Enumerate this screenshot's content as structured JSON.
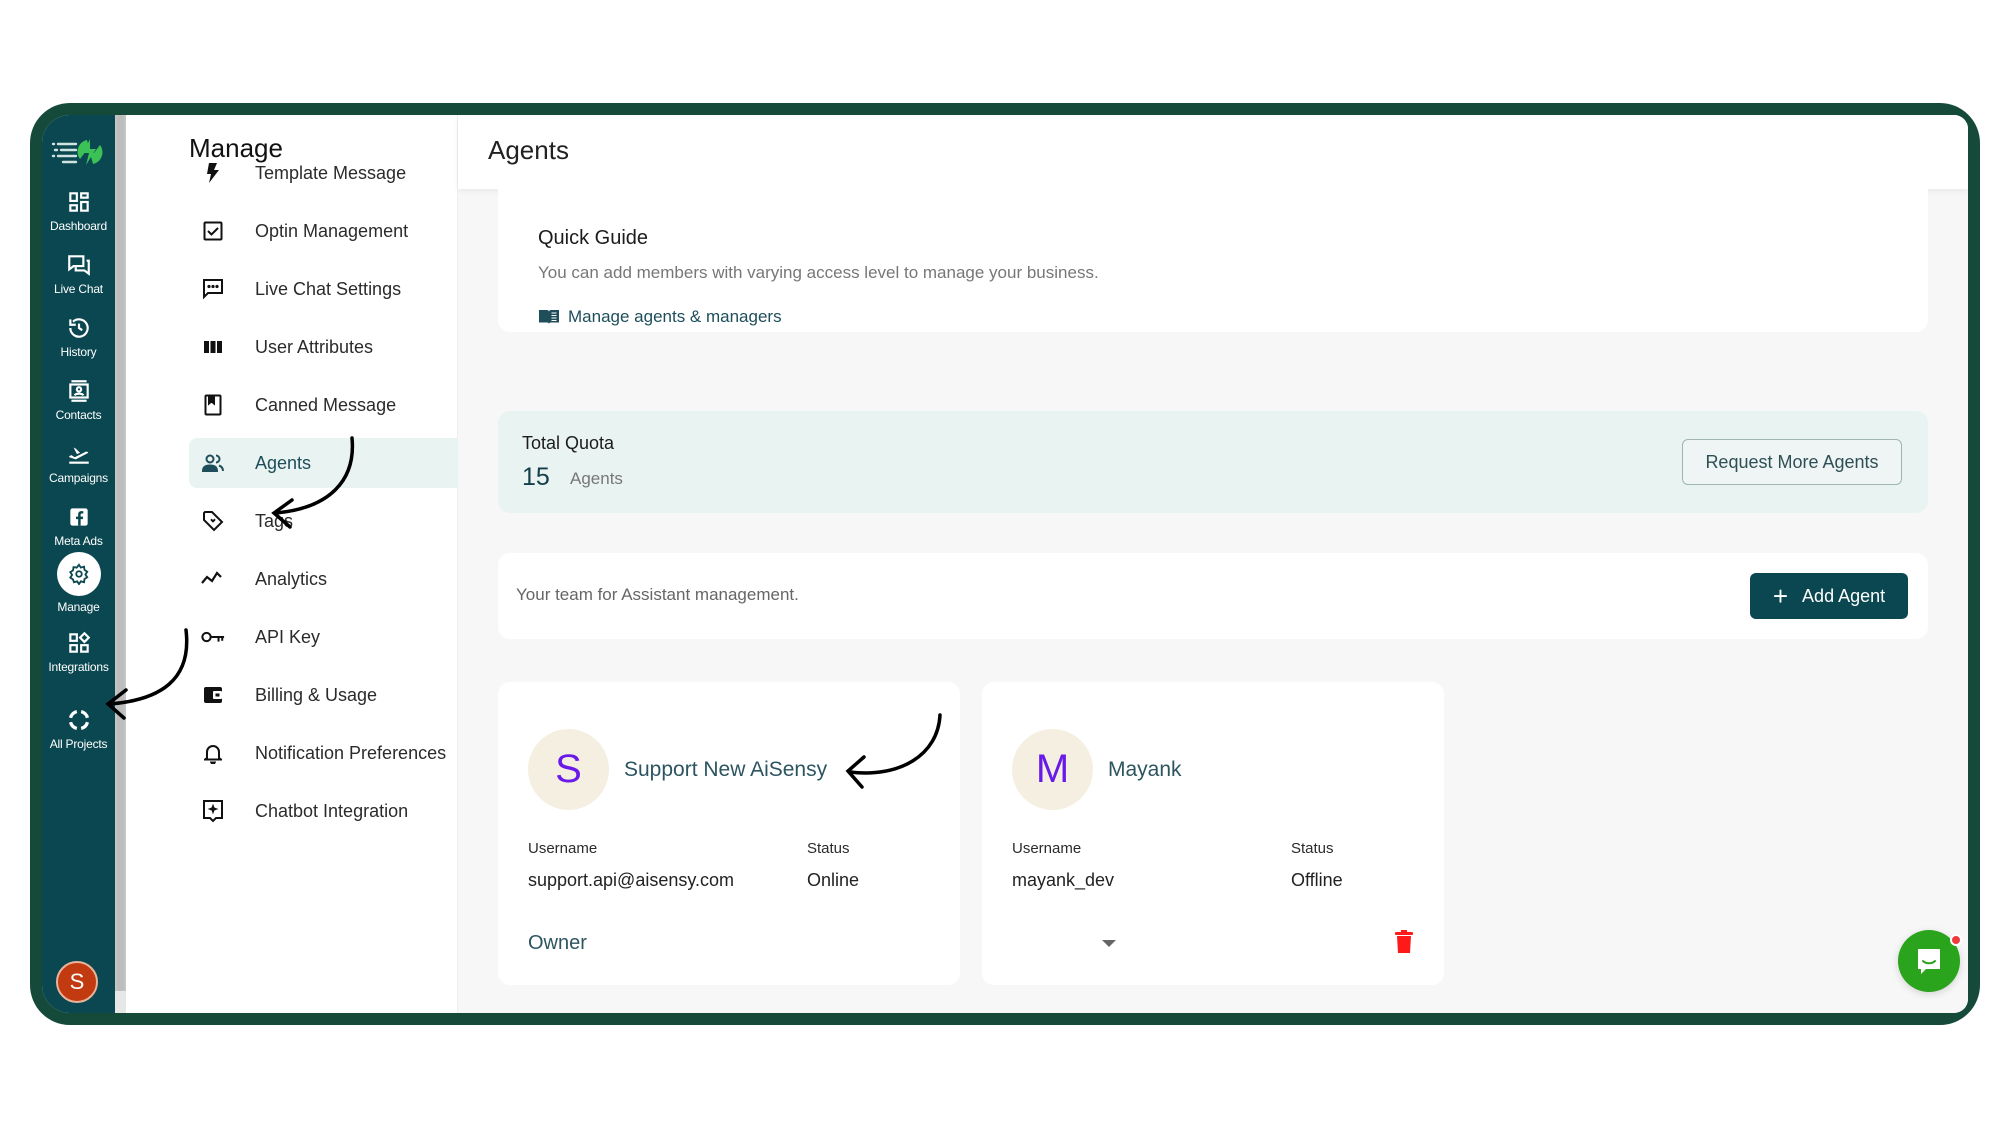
{
  "nav": {
    "items": [
      {
        "label": "Dashboard",
        "icon": "dashboard-icon"
      },
      {
        "label": "Live Chat",
        "icon": "live-chat-icon"
      },
      {
        "label": "History",
        "icon": "history-icon"
      },
      {
        "label": "Contacts",
        "icon": "contacts-icon"
      },
      {
        "label": "Campaigns",
        "icon": "campaigns-icon"
      },
      {
        "label": "Meta Ads",
        "icon": "facebook-icon"
      },
      {
        "label": "Manage",
        "icon": "gear-icon",
        "active": true
      },
      {
        "label": "Integrations",
        "icon": "integrations-icon"
      },
      {
        "label": "All Projects",
        "icon": "projects-icon"
      }
    ],
    "user_initial": "S"
  },
  "manage": {
    "title": "Manage",
    "items": [
      {
        "label": "Template Message",
        "icon": "bolt-icon"
      },
      {
        "label": "Optin Management",
        "icon": "checkbox-icon"
      },
      {
        "label": "Live Chat Settings",
        "icon": "chat-dots-icon"
      },
      {
        "label": "User Attributes",
        "icon": "columns-icon"
      },
      {
        "label": "Canned Message",
        "icon": "bookmark-icon"
      },
      {
        "label": "Agents",
        "icon": "people-icon",
        "active": true
      },
      {
        "label": "Tags",
        "icon": "tag-icon"
      },
      {
        "label": "Analytics",
        "icon": "analytics-icon"
      },
      {
        "label": "API Key",
        "icon": "key-icon"
      },
      {
        "label": "Billing & Usage",
        "icon": "wallet-icon"
      },
      {
        "label": "Notification Preferences",
        "icon": "bell-icon"
      },
      {
        "label": "Chatbot Integration",
        "icon": "chatbot-icon"
      }
    ]
  },
  "header": {
    "title": "Agents"
  },
  "guide": {
    "title": "Quick Guide",
    "description": "You can add members with varying access level to manage your business.",
    "link_label": "Manage agents & managers"
  },
  "quota": {
    "title": "Total Quota",
    "count": "15",
    "unit": "Agents",
    "request_button": "Request More Agents"
  },
  "team": {
    "description": "Your team for Assistant management.",
    "add_button": "Add Agent"
  },
  "agents": [
    {
      "initial": "S",
      "name": "Support New AiSensy",
      "username_label": "Username",
      "username": "support.api@aisensy.com",
      "status_label": "Status",
      "status": "Online",
      "role": "Owner"
    },
    {
      "initial": "M",
      "name": "Mayank",
      "username_label": "Username",
      "username": "mayank_dev",
      "status_label": "Status",
      "status": "Offline",
      "role": ""
    }
  ],
  "colors": {
    "frame": "#154a3a",
    "nav_bg": "#0b4750",
    "accent": "#0b4750",
    "active_bg": "#e9f3f2",
    "avatar_text": "#6a1ae8",
    "delete": "#ff1a1a",
    "chat_fab": "#2aa31d"
  }
}
